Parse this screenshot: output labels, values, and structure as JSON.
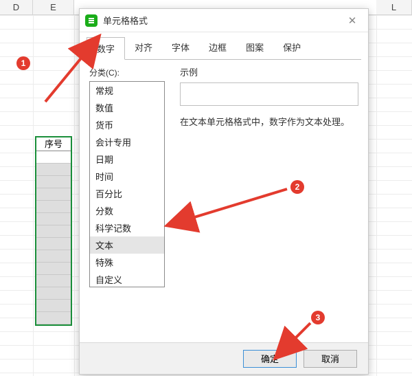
{
  "sheet": {
    "columns": [
      "D",
      "E",
      "",
      "",
      "",
      "",
      "",
      "L"
    ],
    "seq_header": "序号"
  },
  "dialog": {
    "title": "单元格格式",
    "tabs": [
      "数字",
      "对齐",
      "字体",
      "边框",
      "图案",
      "保护"
    ],
    "active_tab": 0,
    "category_label": "分类(C):",
    "categories": [
      "常规",
      "数值",
      "货币",
      "会计专用",
      "日期",
      "时间",
      "百分比",
      "分数",
      "科学记数",
      "文本",
      "特殊",
      "自定义"
    ],
    "selected_category": 9,
    "example_label": "示例",
    "hint": "在文本单元格格式中，数字作为文本处理。",
    "ok": "确定",
    "cancel": "取消"
  },
  "annotations": {
    "b1": "1",
    "b2": "2",
    "b3": "3"
  }
}
